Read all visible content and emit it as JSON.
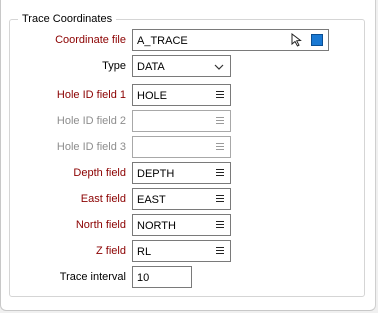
{
  "group": {
    "title": "Trace Coordinates"
  },
  "fields": {
    "coordinate_file": {
      "label": "Coordinate file",
      "value": "A_TRACE"
    },
    "type": {
      "label": "Type",
      "value": "DATA"
    },
    "hole_id_1": {
      "label": "Hole ID field 1",
      "value": "HOLE"
    },
    "hole_id_2": {
      "label": "Hole ID field 2",
      "value": ""
    },
    "hole_id_3": {
      "label": "Hole ID field 3",
      "value": ""
    },
    "depth": {
      "label": "Depth field",
      "value": "DEPTH"
    },
    "east": {
      "label": "East field",
      "value": "EAST"
    },
    "north": {
      "label": "North field",
      "value": "NORTH"
    },
    "z": {
      "label": "Z field",
      "value": "RL"
    },
    "trace_interval": {
      "label": "Trace interval",
      "value": "10"
    }
  },
  "icons": {
    "coordinate_file_pick": "cursor-pick-icon",
    "coordinate_file_browse": "blue-square-icon",
    "field_list": "menu-lines-icon",
    "dropdown": "chevron-down-icon"
  },
  "colors": {
    "required_label": "#8b0000",
    "disabled_label": "#8d8d8d",
    "browse_square": "#1a79d3"
  }
}
